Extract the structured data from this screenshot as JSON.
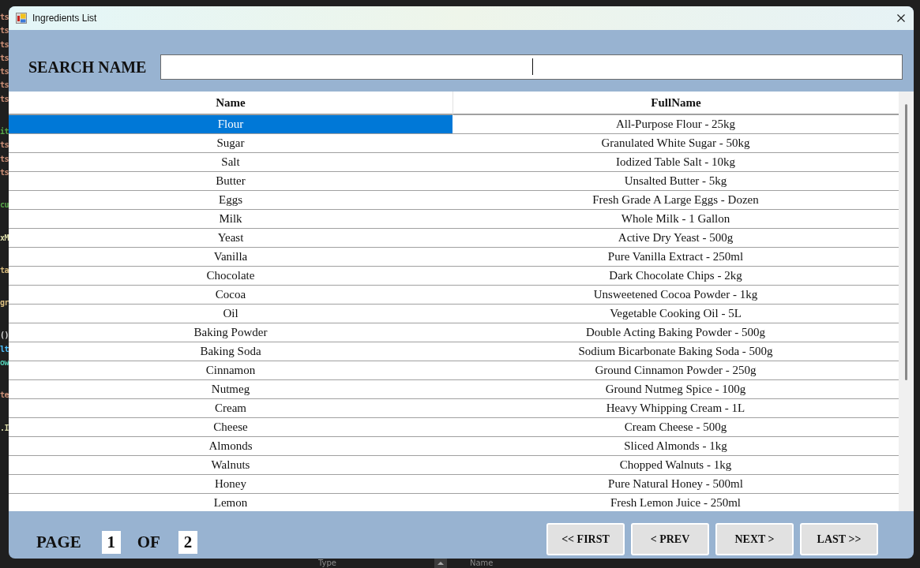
{
  "background_editor": {
    "code_blocks": [
      [
        {
          "text": "ts",
          "color": "#ce9178"
        },
        {
          "text": "ts",
          "color": "#ce9178"
        },
        {
          "text": "ts",
          "color": "#ce9178"
        },
        {
          "text": "ts",
          "color": "#ce9178"
        },
        {
          "text": "ts",
          "color": "#ce9178"
        },
        {
          "text": "ts",
          "color": "#ce9178"
        },
        {
          "text": "ts",
          "color": "#ce9178"
        }
      ],
      [
        {
          "text": "it",
          "color": "#57a64a"
        },
        {
          "text": "ts",
          "color": "#ce9178"
        },
        {
          "text": "ts",
          "color": "#ce9178"
        },
        {
          "text": "ts",
          "color": "#ce9178"
        }
      ],
      [
        {
          "text": "cu",
          "color": "#57a64a"
        }
      ],
      [
        {
          "text": "xM",
          "color": "#dcdcaa"
        }
      ],
      [
        {
          "text": "ta",
          "color": "#d7ba7d"
        }
      ],
      [
        {
          "text": "gr",
          "color": "#d7ba7d"
        }
      ],
      [
        {
          "text": "()",
          "color": "#dcdcdc"
        },
        {
          "text": "lt",
          "color": "#4fc1ff"
        },
        {
          "text": "ow",
          "color": "#4ec9b0"
        }
      ],
      [
        {
          "text": "te",
          "color": "#ce9178"
        }
      ],
      [
        {
          "text": ".I",
          "color": "#dcdcaa"
        }
      ]
    ],
    "panel_columns": [
      "Type",
      "Name"
    ]
  },
  "window": {
    "title": "Ingredients List"
  },
  "search": {
    "label": "SEARCH NAME"
  },
  "table": {
    "columns": [
      "Name",
      "FullName"
    ],
    "rows": [
      {
        "name": "Flour",
        "full_name": "All-Purpose Flour - 25kg",
        "selected": true
      },
      {
        "name": "Sugar",
        "full_name": "Granulated White Sugar - 50kg",
        "selected": false
      },
      {
        "name": "Salt",
        "full_name": "Iodized Table Salt - 10kg",
        "selected": false
      },
      {
        "name": "Butter",
        "full_name": "Unsalted Butter - 5kg",
        "selected": false
      },
      {
        "name": "Eggs",
        "full_name": "Fresh Grade A Large Eggs - Dozen",
        "selected": false
      },
      {
        "name": "Milk",
        "full_name": "Whole Milk - 1 Gallon",
        "selected": false
      },
      {
        "name": "Yeast",
        "full_name": "Active Dry Yeast - 500g",
        "selected": false
      },
      {
        "name": "Vanilla",
        "full_name": "Pure Vanilla Extract - 250ml",
        "selected": false
      },
      {
        "name": "Chocolate",
        "full_name": "Dark Chocolate Chips - 2kg",
        "selected": false
      },
      {
        "name": "Cocoa",
        "full_name": "Unsweetened Cocoa Powder - 1kg",
        "selected": false
      },
      {
        "name": "Oil",
        "full_name": "Vegetable Cooking Oil - 5L",
        "selected": false
      },
      {
        "name": "Baking Powder",
        "full_name": "Double Acting Baking Powder - 500g",
        "selected": false
      },
      {
        "name": "Baking Soda",
        "full_name": "Sodium Bicarbonate Baking Soda - 500g",
        "selected": false
      },
      {
        "name": "Cinnamon",
        "full_name": "Ground Cinnamon Powder - 250g",
        "selected": false
      },
      {
        "name": "Nutmeg",
        "full_name": "Ground Nutmeg Spice - 100g",
        "selected": false
      },
      {
        "name": "Cream",
        "full_name": "Heavy Whipping Cream - 1L",
        "selected": false
      },
      {
        "name": "Cheese",
        "full_name": "Cream Cheese - 500g",
        "selected": false
      },
      {
        "name": "Almonds",
        "full_name": "Sliced Almonds - 1kg",
        "selected": false
      },
      {
        "name": "Walnuts",
        "full_name": "Chopped Walnuts - 1kg",
        "selected": false
      },
      {
        "name": "Honey",
        "full_name": "Pure Natural Honey - 500ml",
        "selected": false
      },
      {
        "name": "Lemon",
        "full_name": "Fresh Lemon Juice - 250ml",
        "selected": false
      }
    ]
  },
  "pager": {
    "page_label": "PAGE",
    "page": "1",
    "of_label": "OF",
    "total": "2",
    "buttons": [
      "<< FIRST",
      "< PREV",
      "NEXT >",
      "LAST >>"
    ]
  }
}
